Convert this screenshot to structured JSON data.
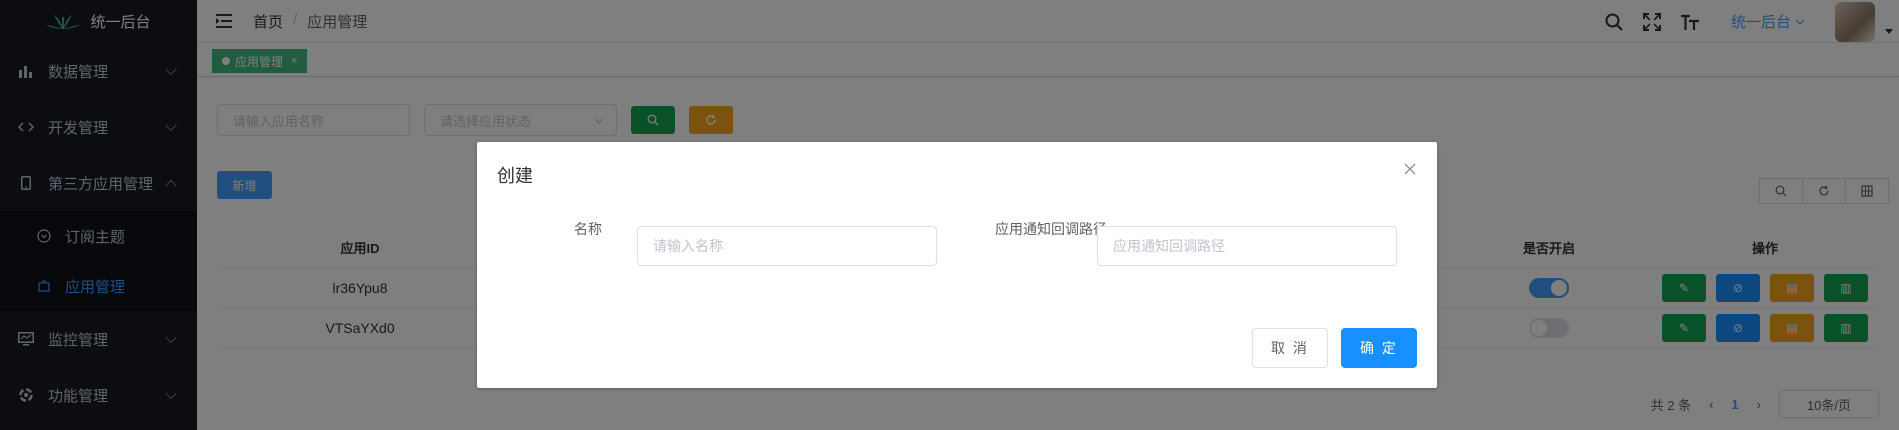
{
  "app": {
    "title": "统一后台"
  },
  "sidebar": {
    "items": [
      {
        "label": "数据管理"
      },
      {
        "label": "开发管理"
      },
      {
        "label": "第三方应用管理"
      },
      {
        "label": "监控管理"
      },
      {
        "label": "功能管理"
      }
    ],
    "submenu": [
      {
        "label": "订阅主题"
      },
      {
        "label": "应用管理"
      }
    ]
  },
  "header": {
    "breadcrumb": {
      "home": "首页",
      "separator": "/",
      "current": "应用管理"
    },
    "system_switch": "统一后台"
  },
  "tags": [
    {
      "label": "应用管理",
      "close": "×"
    }
  ],
  "filters": {
    "name_placeholder": "请输入应用名称",
    "status_placeholder": "请选择应用状态"
  },
  "toolbar": {
    "add_label": "新增"
  },
  "table": {
    "headers": {
      "id": "应用ID",
      "enabled": "是否开启",
      "ops": "操作"
    },
    "rows": [
      {
        "id": "lr36Ypu8",
        "enabled": true
      },
      {
        "id": "VTSaYXd0",
        "enabled": false
      }
    ]
  },
  "pagination": {
    "total": "共 2 条",
    "current_page": "1",
    "page_size": "10条/页"
  },
  "dialog": {
    "title": "创建",
    "name_label": "名称",
    "name_placeholder": "请输入名称",
    "callback_label": "应用通知回调路径",
    "callback_placeholder": "应用通知回调路径",
    "cancel_label": "取 消",
    "confirm_label": "确 定"
  },
  "colors": {
    "sidebar_bg": "#191a23",
    "accent_blue": "#409eff",
    "success_green": "#13a453",
    "warning_orange": "#f7a51c",
    "tag_green": "#42b983",
    "confirm_blue": "#1890ff"
  },
  "icons": {
    "menu": [
      "bar-chart-icon",
      "code-icon",
      "mobile-icon",
      "monitor-icon",
      "function-icon"
    ],
    "header": [
      "search-icon",
      "fullscreen-icon",
      "font-size-icon"
    ],
    "ops": [
      "edit-icon",
      "link-icon",
      "detail-icon",
      "config-icon"
    ]
  }
}
